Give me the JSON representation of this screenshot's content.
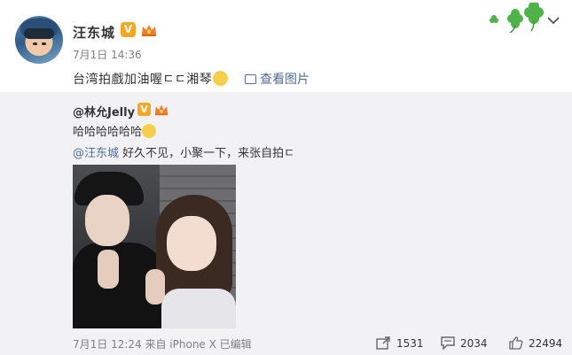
{
  "post": {
    "username": "汪东城",
    "verified_badge": "V",
    "timestamp": "7月1日 14:36",
    "text": "台湾拍戲加油喔ㄷㄷ湘琴",
    "view_pictures": "查看图片"
  },
  "repost": {
    "username": "@林允Jelly",
    "verified_badge": "V",
    "line1": "哈哈哈哈哈哈",
    "mention": "@汪东城",
    "line2_rest": " 好久不见，小聚一下，来张自拍ㄷ"
  },
  "footer": {
    "meta": "7月1日 12:24 来自 iPhone X   已编辑",
    "repost_count": "1531",
    "comment_count": "2034",
    "like_count": "22494"
  },
  "icons": {
    "clover": "clover-decoration-icon",
    "dropdown": "chevron-down-icon",
    "view_pic": "image-icon",
    "repost": "repost-icon",
    "comment": "comment-icon",
    "like": "thumbs-up-icon"
  },
  "colors": {
    "link": "#4f6e96",
    "badge": "#f5a623",
    "repost_bg": "#f2f2f5",
    "clover": "#4fb34a"
  }
}
